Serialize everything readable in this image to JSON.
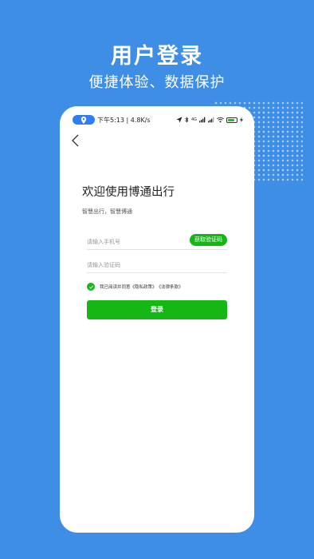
{
  "banner": {
    "headline": "用户登录",
    "subline": "便捷体验、数据保护"
  },
  "status_bar": {
    "time_speed": "下午5:13 | 4.8K/s",
    "network_label": "4G"
  },
  "login": {
    "title": "欢迎使用博通出行",
    "slogan": "智慧出行，智慧博通",
    "phone_placeholder": "请输入手机号",
    "get_code_label": "获取验证码",
    "code_placeholder": "请输入验证码",
    "agree_prefix": "我已阅读并同意",
    "privacy_link": "《隐私政策》",
    "terms_link": "《法律条款》",
    "login_label": "登录"
  },
  "colors": {
    "background": "#3f8ee6",
    "accent_green": "#15b715",
    "location_pill": "#2d7ef0"
  },
  "icons": {
    "back": "chevron-left-icon",
    "location": "location-pin-icon",
    "navigation": "navigation-arrow-icon",
    "bluetooth": "bluetooth-icon",
    "wifi": "wifi-icon",
    "battery": "battery-icon",
    "check": "check-icon"
  }
}
